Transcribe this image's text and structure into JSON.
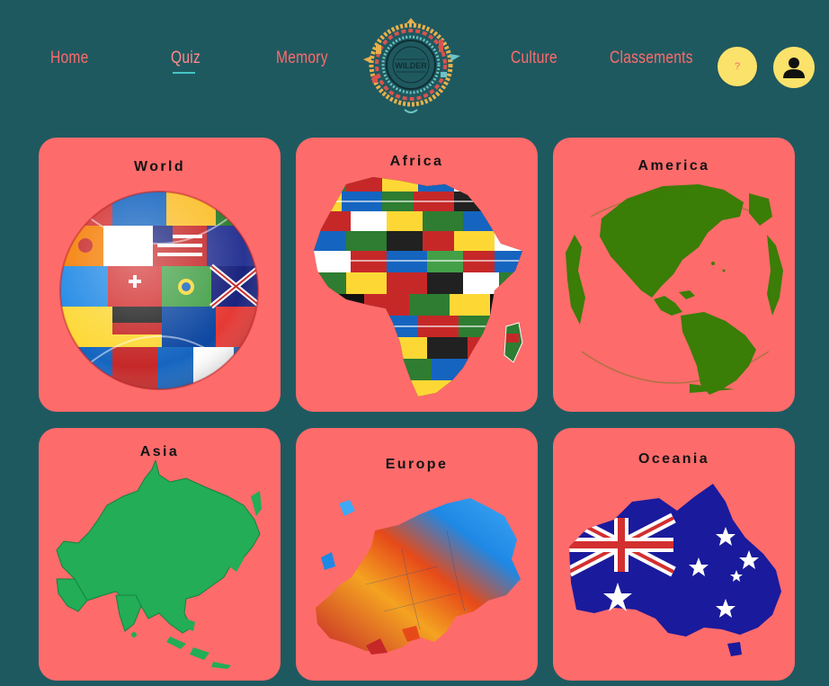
{
  "nav": {
    "home": "Home",
    "quiz": "Quiz",
    "memory": "Memory",
    "culture": "Culture",
    "rankings": "Classements"
  },
  "logo": {
    "text": "WILDER"
  },
  "actions": {
    "help_label": "?",
    "help_icon": "question-icon",
    "user_icon": "user-icon"
  },
  "cards": [
    {
      "title": "World",
      "image": "flag-globe"
    },
    {
      "title": "Africa",
      "image": "africa-flags-map"
    },
    {
      "title": "America",
      "image": "americas-globe"
    },
    {
      "title": "Asia",
      "image": "asia-map"
    },
    {
      "title": "Europe",
      "image": "europe-map"
    },
    {
      "title": "Oceania",
      "image": "australia-flag-map"
    }
  ],
  "colors": {
    "background": "#1f5960",
    "card": "#fe6b6b",
    "accent_yellow": "#fbe26a",
    "nav_text": "#ff6b6b",
    "active_underline": "#43c6c6"
  }
}
